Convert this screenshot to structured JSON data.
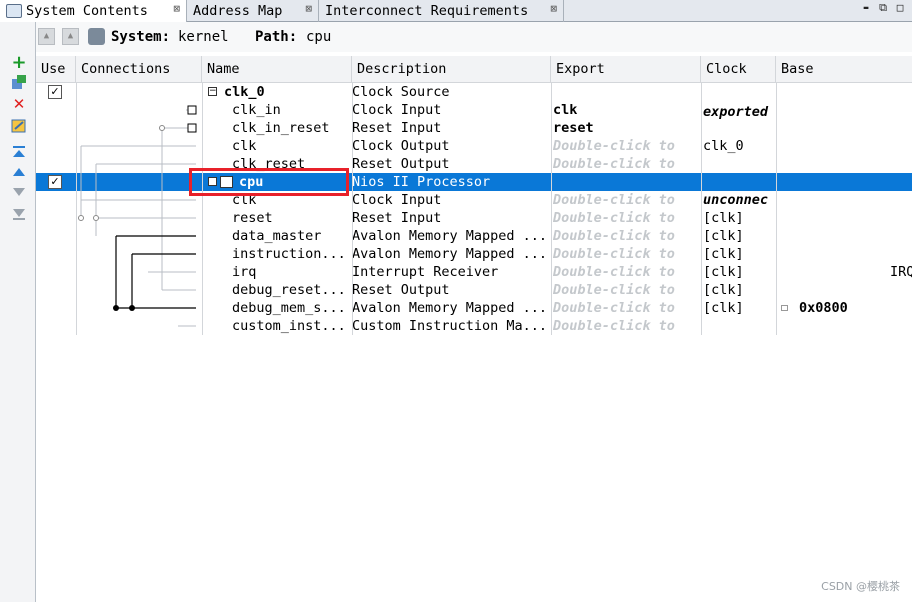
{
  "tabs": [
    {
      "label": "System Contents",
      "active": true
    },
    {
      "label": "Address Map",
      "active": false
    },
    {
      "label": "Interconnect Requirements",
      "active": false
    }
  ],
  "window_controls": {
    "min": "▬",
    "max": "⬚"
  },
  "pathbar": {
    "system_label": "System:",
    "system_value": "kernel",
    "path_label": "Path:",
    "path_value": "cpu"
  },
  "columns": {
    "use": "Use",
    "connections": "Connections",
    "name": "Name",
    "description": "Description",
    "export": "Export",
    "clock": "Clock",
    "base": "Base"
  },
  "rows": [
    {
      "name": "clk_0",
      "description": "Clock Source",
      "export": "",
      "clock": "",
      "base": "",
      "level": 0,
      "expander": "⊟",
      "use": "✓"
    },
    {
      "name": "clk_in",
      "description": "Clock Input",
      "export": "clk",
      "clock": "exported",
      "base": "",
      "level": 1
    },
    {
      "name": "clk_in_reset",
      "description": "Reset Input",
      "export": "reset",
      "clock": "",
      "base": "",
      "level": 1
    },
    {
      "name": "clk",
      "description": "Clock Output",
      "export": "Double-click to",
      "clock": "clk_0",
      "base": "",
      "level": 1
    },
    {
      "name": "clk_reset",
      "description": "Reset Output",
      "export": "Double-click to",
      "clock": "",
      "base": "",
      "level": 1
    },
    {
      "name": "cpu",
      "description": "Nios II Processor",
      "export": "",
      "clock": "",
      "base": "",
      "level": 0,
      "expander": "⊟",
      "use": "✓",
      "selected": true
    },
    {
      "name": "clk",
      "description": "Clock Input",
      "export": "Double-click to",
      "clock": "unconnec",
      "base": "",
      "level": 1
    },
    {
      "name": "reset",
      "description": "Reset Input",
      "export": "Double-click to",
      "clock": "[clk]",
      "base": "",
      "level": 1
    },
    {
      "name": "data_master",
      "description": "Avalon Memory Mapped ...",
      "export": "Double-click to",
      "clock": "[clk]",
      "base": "",
      "level": 1
    },
    {
      "name": "instruction...",
      "description": "Avalon Memory Mapped ...",
      "export": "Double-click to",
      "clock": "[clk]",
      "base": "",
      "level": 1
    },
    {
      "name": "irq",
      "description": "Interrupt Receiver",
      "export": "Double-click to",
      "clock": "[clk]",
      "base": "IRQ",
      "level": 1
    },
    {
      "name": "debug_reset...",
      "description": "Reset Output",
      "export": "Double-click to",
      "clock": "[clk]",
      "base": "",
      "level": 1
    },
    {
      "name": "debug_mem_s...",
      "description": "Avalon Memory Mapped ...",
      "export": "Double-click to",
      "clock": "[clk]",
      "base": "0x0800",
      "level": 1
    },
    {
      "name": "custom_inst...",
      "description": "Custom Instruction Ma...",
      "export": "Double-click to",
      "clock": "",
      "base": "",
      "level": 1
    }
  ],
  "watermark": "CSDN @樱桃茶",
  "colors": {
    "selection": "#0a78d7",
    "highlight": "#e8212a",
    "hint": "#c4c8cc"
  }
}
